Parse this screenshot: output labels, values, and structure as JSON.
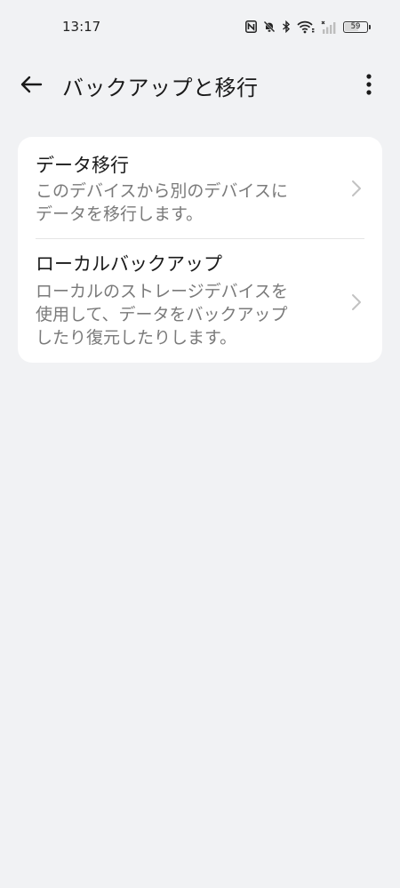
{
  "status_bar": {
    "time": "13:17",
    "battery_level": "59",
    "icons": [
      "nfc-icon",
      "mute-icon",
      "bluetooth-icon",
      "wifi-icon",
      "signal-icon",
      "battery-icon"
    ]
  },
  "header": {
    "title": "バックアップと移行",
    "back_icon": "arrow-left-icon",
    "more_icon": "more-vertical-icon"
  },
  "items": [
    {
      "title": "データ移行",
      "description": "このデバイスから別のデバイスに\nデータを移行します。"
    },
    {
      "title": "ローカルバックアップ",
      "description": "ローカルのストレージデバイスを\n使用して、データをバックアップ\nしたり復元したりします。"
    }
  ],
  "colors": {
    "background": "#f1f2f4",
    "card": "#ffffff",
    "secondary_text": "#7a7a7a"
  }
}
